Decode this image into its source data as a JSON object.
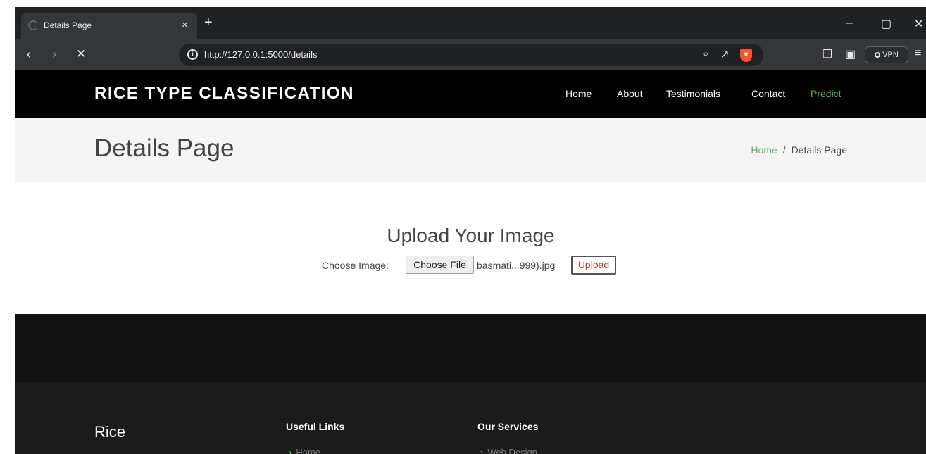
{
  "browser": {
    "tab_title": "Details Page",
    "tab_close": "×",
    "new_tab": "+",
    "url": "http://127.0.0.1:5000/details",
    "vpn_label": "VPN",
    "window_controls": {
      "minimize": "–",
      "maximize": "▢",
      "close": "✕"
    },
    "icons": [
      "back-icon",
      "forward-icon",
      "stop-icon",
      "info-icon",
      "zoom-icon",
      "share-icon",
      "brave-shield-icon",
      "extensions-icon",
      "wallet-icon",
      "menu-icon"
    ]
  },
  "site": {
    "brand": "RICE TYPE CLASSIFICATION",
    "nav": [
      {
        "label": "Home"
      },
      {
        "label": "About"
      },
      {
        "label": "Testimonials"
      },
      {
        "label": "Contact"
      },
      {
        "label": "Predict",
        "active": true
      }
    ],
    "accent_color": "#5fae6a"
  },
  "breadcrumb": {
    "page_title": "Details Page",
    "home": "Home",
    "separator": "/",
    "current": "Details Page"
  },
  "upload": {
    "title": "Upload Your Image",
    "choose_label": "Choose Image:",
    "choose_button": "Choose File",
    "file_name": "basmati...999).jpg",
    "upload_button": "Upload"
  },
  "footer": {
    "brand": "Rice",
    "useful_links_heading": "Useful Links",
    "useful_links_first": "Home",
    "services_heading": "Our Services",
    "services_first": "Web Design"
  }
}
